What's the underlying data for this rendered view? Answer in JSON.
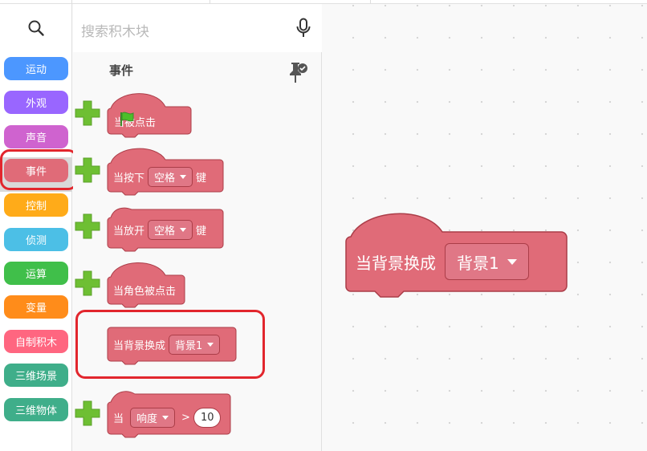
{
  "search": {
    "placeholder": "搜索积木块"
  },
  "categories": [
    {
      "label": "运动",
      "color": "#4c97ff"
    },
    {
      "label": "外观",
      "color": "#9966ff"
    },
    {
      "label": "声音",
      "color": "#cf63cf"
    },
    {
      "label": "事件",
      "color": "#e06b78"
    },
    {
      "label": "控制",
      "color": "#ffab19"
    },
    {
      "label": "侦测",
      "color": "#4cbfe6"
    },
    {
      "label": "运算",
      "color": "#40bf4a"
    },
    {
      "label": "变量",
      "color": "#ff8c1a"
    },
    {
      "label": "自制积木",
      "color": "#ff6680"
    },
    {
      "label": "三维场景",
      "color": "#3fae8a"
    },
    {
      "label": "三维物体",
      "color": "#3fae8a"
    }
  ],
  "selected_category": "事件",
  "palette": {
    "section_title": "事件",
    "blocks": {
      "flag_clicked": {
        "when": "当",
        "suffix": "被点击"
      },
      "key_pressed": {
        "prefix": "当按下",
        "dropdown": "空格",
        "suffix": "键"
      },
      "key_released": {
        "prefix": "当放开",
        "dropdown": "空格",
        "suffix": "键"
      },
      "sprite_clicked": {
        "text": "当角色被点击"
      },
      "backdrop_switch": {
        "prefix": "当背景换成",
        "dropdown": "背景1"
      },
      "loudness": {
        "when": "当",
        "dropdown": "响度",
        "operator": ">",
        "value": "10"
      }
    }
  },
  "workspace": {
    "block": {
      "prefix": "当背景换成",
      "dropdown": "背景1"
    }
  },
  "colors": {
    "event_block": "#e06b78",
    "event_border": "#ab3d48",
    "highlight": "#e2262d",
    "plus": "#6ebf33"
  }
}
